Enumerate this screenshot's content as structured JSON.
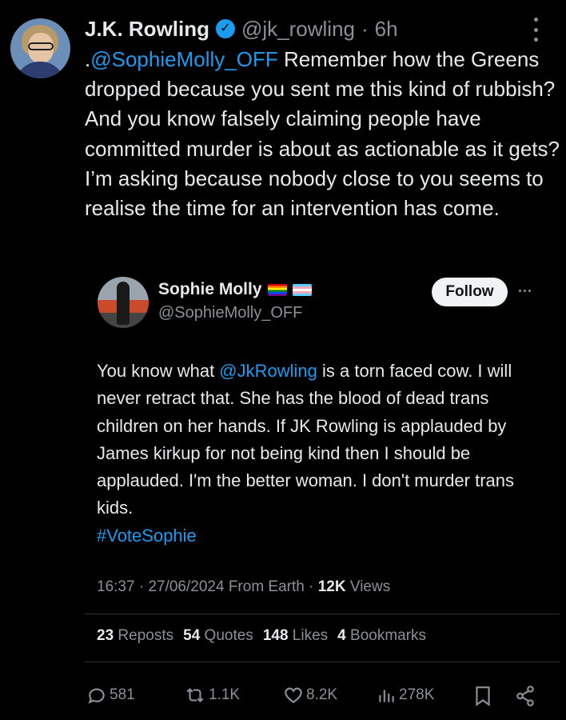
{
  "post": {
    "author_name": "J.K. Rowling",
    "author_handle": "@jk_rowling",
    "separator": "·",
    "age": "6h",
    "text_prefix": ".",
    "text_mention": "@SophieMolly_OFF",
    "text_body": " Remember how the Greens dropped because you sent me this kind of rubbish? And you know falsely claiming people have committed murder is about as actionable as it gets? I’m asking because nobody close to you seems to realise the time for an intervention has come."
  },
  "quoted": {
    "name": "Sophie Molly",
    "handle": "@SophieMolly_OFF",
    "follow_label": "Follow",
    "text_part1": "You know what ",
    "text_mention": "@JkRowling",
    "text_part2": " is a torn faced cow. I will never retract that. She has the blood of dead trans children on her hands. If JK Rowling is applauded by James kirkup for not being kind then I should be applauded. I'm the better woman. I don't murder trans kids.",
    "hashtag": "#VoteSophie"
  },
  "meta": {
    "time": "16:37",
    "separator": "·",
    "date": "27/06/2024",
    "source": "From Earth",
    "views_count": "12K",
    "views_label": "Views"
  },
  "stats": {
    "reposts_count": "23",
    "reposts_label": "Reposts",
    "quotes_count": "54",
    "quotes_label": "Quotes",
    "likes_count": "148",
    "likes_label": "Likes",
    "bookmarks_count": "4",
    "bookmarks_label": "Bookmarks"
  },
  "actions": {
    "replies": "581",
    "reposts": "1.1K",
    "likes": "8.2K",
    "views": "278K"
  },
  "colors": {
    "background": "#000000",
    "text": "#e7e9ea",
    "secondary": "#8b9096",
    "link": "#1d9bf0",
    "verified": "#1d9bf0"
  },
  "icons": {
    "verified": "verified-badge-icon",
    "more": "more-vertical-icon",
    "quoted_more": "more-horizontal-icon",
    "reply": "reply-icon",
    "repost": "repost-icon",
    "like": "heart-icon",
    "views": "views-chart-icon",
    "bookmark": "bookmark-icon",
    "share": "share-icon"
  }
}
